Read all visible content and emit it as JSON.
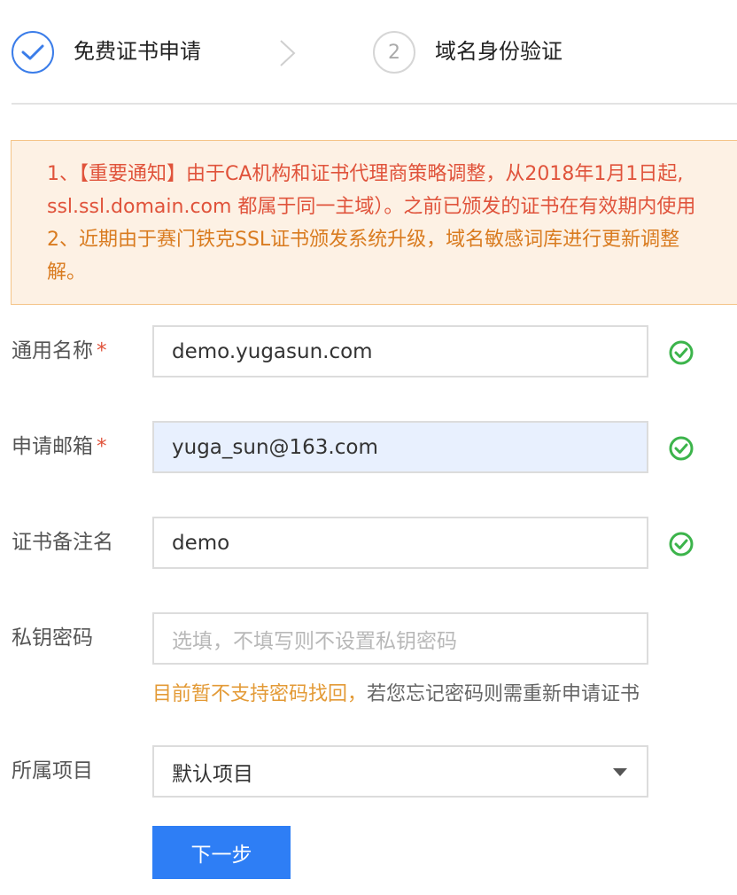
{
  "steps": [
    {
      "label": "免费证书申请",
      "status": "done"
    },
    {
      "number": "2",
      "label": "域名身份验证",
      "status": "pending"
    }
  ],
  "notice": {
    "line1": "1、【重要通知】由于CA机构和证书代理商策略调整，从2018年1月1日起,",
    "line2": "ssl.ssl.domain.com 都属于同一主域）。之前已颁发的证书在有效期内使用",
    "line3": "2、近期由于赛门铁克SSL证书颁发系统升级，域名敏感词库进行更新调整",
    "line4": "解。"
  },
  "form": {
    "common_name": {
      "label": "通用名称",
      "required": "*",
      "value": "demo.yugasun.com",
      "valid": true
    },
    "email": {
      "label": "申请邮箱",
      "required": "*",
      "value": "yuga_sun@163.com",
      "valid": true
    },
    "remark": {
      "label": "证书备注名",
      "value": "demo",
      "valid": true
    },
    "private_key_password": {
      "label": "私钥密码",
      "placeholder": "选填，不填写则不设置私钥密码",
      "hint_warning": "目前暂不支持密码找回，",
      "hint_rest": "若您忘记密码则需重新申请证书"
    },
    "project": {
      "label": "所属项目",
      "value": "默认项目"
    }
  },
  "buttons": {
    "next": "下一步"
  },
  "colors": {
    "primary": "#2e7ef5",
    "success": "#3cb44b",
    "notice_text_red": "#e0533b",
    "notice_text_orange": "#d97b1f",
    "notice_bg": "#fdf1e4",
    "warning_hint": "#e39a36"
  },
  "icons": {
    "step1": "checkmark-icon",
    "step_separator": "chevron-right-icon",
    "valid": "check-circle-icon",
    "select": "caret-down-icon"
  }
}
